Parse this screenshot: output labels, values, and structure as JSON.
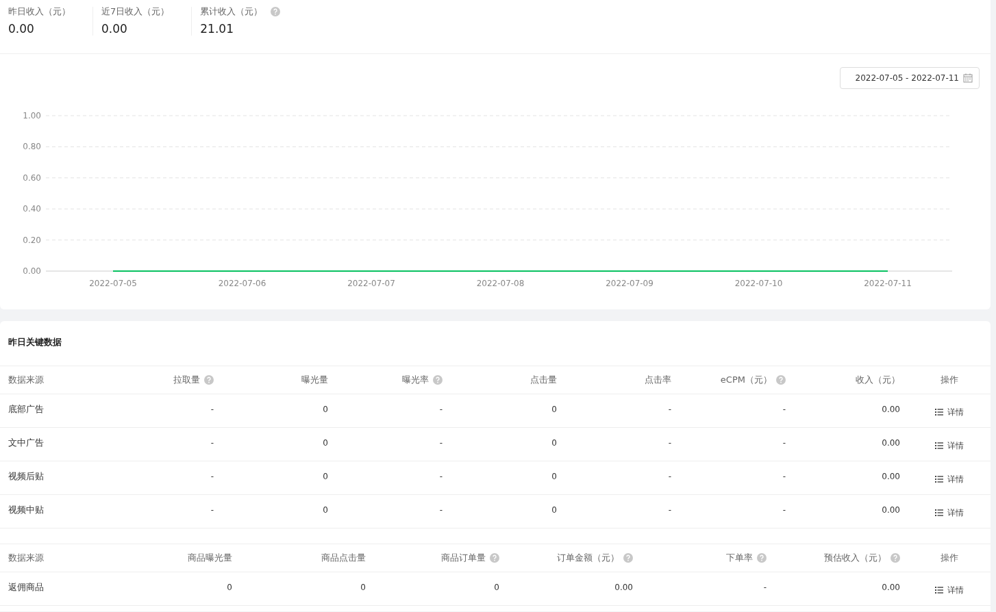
{
  "stats": [
    {
      "label": "昨日收入（元）",
      "value": "0.00",
      "help": false
    },
    {
      "label": "近7日收入（元）",
      "value": "0.00",
      "help": false
    },
    {
      "label": "累计收入（元）",
      "value": "21.01",
      "help": true
    }
  ],
  "date_range": "2022-07-05 - 2022-07-11",
  "chart_data": {
    "type": "line",
    "categories": [
      "2022-07-05",
      "2022-07-06",
      "2022-07-07",
      "2022-07-08",
      "2022-07-09",
      "2022-07-10",
      "2022-07-11"
    ],
    "grid": true,
    "series": [
      {
        "color": "#07c160",
        "values": [
          0,
          0,
          0,
          0,
          0,
          0,
          0
        ]
      }
    ],
    "ylim": [
      0,
      1
    ],
    "yticks": [
      {
        "value": 0,
        "label": "0.00"
      },
      {
        "value": 0.2,
        "label": "0.20"
      },
      {
        "value": 0.4,
        "label": "0.40"
      },
      {
        "value": 0.6,
        "label": "0.60"
      },
      {
        "value": 0.8,
        "label": "0.80"
      },
      {
        "value": 1,
        "label": "1.00"
      }
    ]
  },
  "section_title": "昨日关键数据",
  "tables": [
    {
      "columns": [
        {
          "label": "数据来源",
          "help": false
        },
        {
          "label": "拉取量",
          "help": true
        },
        {
          "label": "曝光量",
          "help": false
        },
        {
          "label": "曝光率",
          "help": true
        },
        {
          "label": "点击量",
          "help": false
        },
        {
          "label": "点击率",
          "help": false
        },
        {
          "label": "eCPM（元）",
          "help": true
        },
        {
          "label": "收入（元）",
          "help": false
        },
        {
          "label": "操作",
          "help": false
        }
      ],
      "rows": [
        {
          "cells": [
            "底部广告",
            "-",
            "0",
            "-",
            "0",
            "-",
            "-",
            "0.00"
          ],
          "action": "详情"
        },
        {
          "cells": [
            "文中广告",
            "-",
            "0",
            "-",
            "0",
            "-",
            "-",
            "0.00"
          ],
          "action": "详情"
        },
        {
          "cells": [
            "视频后贴",
            "-",
            "0",
            "-",
            "0",
            "-",
            "-",
            "0.00"
          ],
          "action": "详情"
        },
        {
          "cells": [
            "视频中贴",
            "-",
            "0",
            "-",
            "0",
            "-",
            "-",
            "0.00"
          ],
          "action": "详情"
        }
      ]
    },
    {
      "columns": [
        {
          "label": "数据来源",
          "help": false
        },
        {
          "label": "商品曝光量",
          "help": false
        },
        {
          "label": "商品点击量",
          "help": false
        },
        {
          "label": "商品订单量",
          "help": true
        },
        {
          "label": "订单金额（元）",
          "help": true
        },
        {
          "label": "下单率",
          "help": true
        },
        {
          "label": "预估收入（元）",
          "help": true
        },
        {
          "label": "操作",
          "help": false
        }
      ],
      "rows": [
        {
          "cells": [
            "返佣商品",
            "0",
            "0",
            "0",
            "0.00",
            "-",
            "0.00"
          ],
          "action": "详情"
        }
      ]
    }
  ]
}
